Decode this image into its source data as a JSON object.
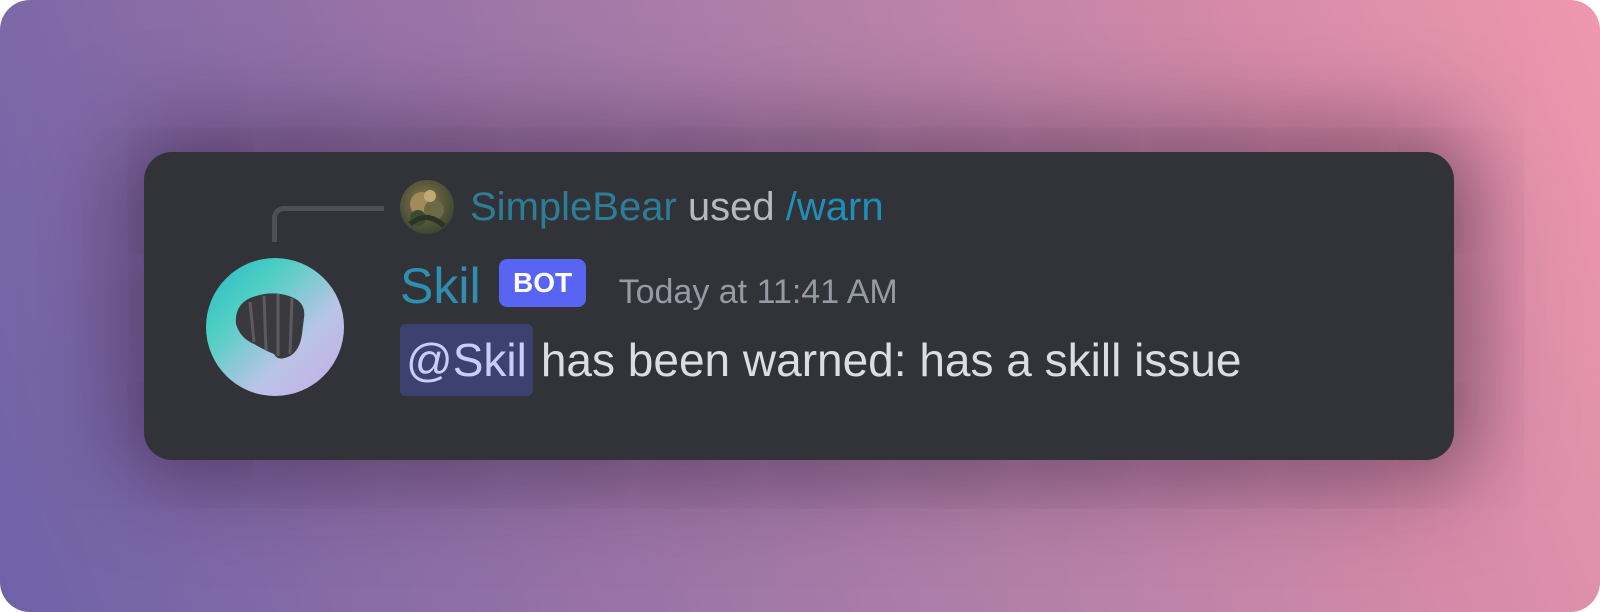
{
  "reply": {
    "username": "SimpleBear",
    "used_text": "used",
    "command": "/warn"
  },
  "message": {
    "author": "Skil",
    "badge": "BOT",
    "timestamp": "Today at 11:41 AM",
    "mention": "@Skil",
    "text": "has been warned: has a skill issue"
  },
  "colors": {
    "background_gradient": [
      "#6e62a8",
      "#ee98ae"
    ],
    "card": "#313338",
    "username": "#2e8fb0",
    "command": "#1f8fb8",
    "bot_badge": "#5865f2",
    "mention_bg": "#3c4270",
    "message_text": "#dbdee1",
    "timestamp": "#949ba4"
  },
  "icons": {
    "reply_avatar": "bear-avatar-icon",
    "author_avatar": "skil-avatar-icon"
  }
}
